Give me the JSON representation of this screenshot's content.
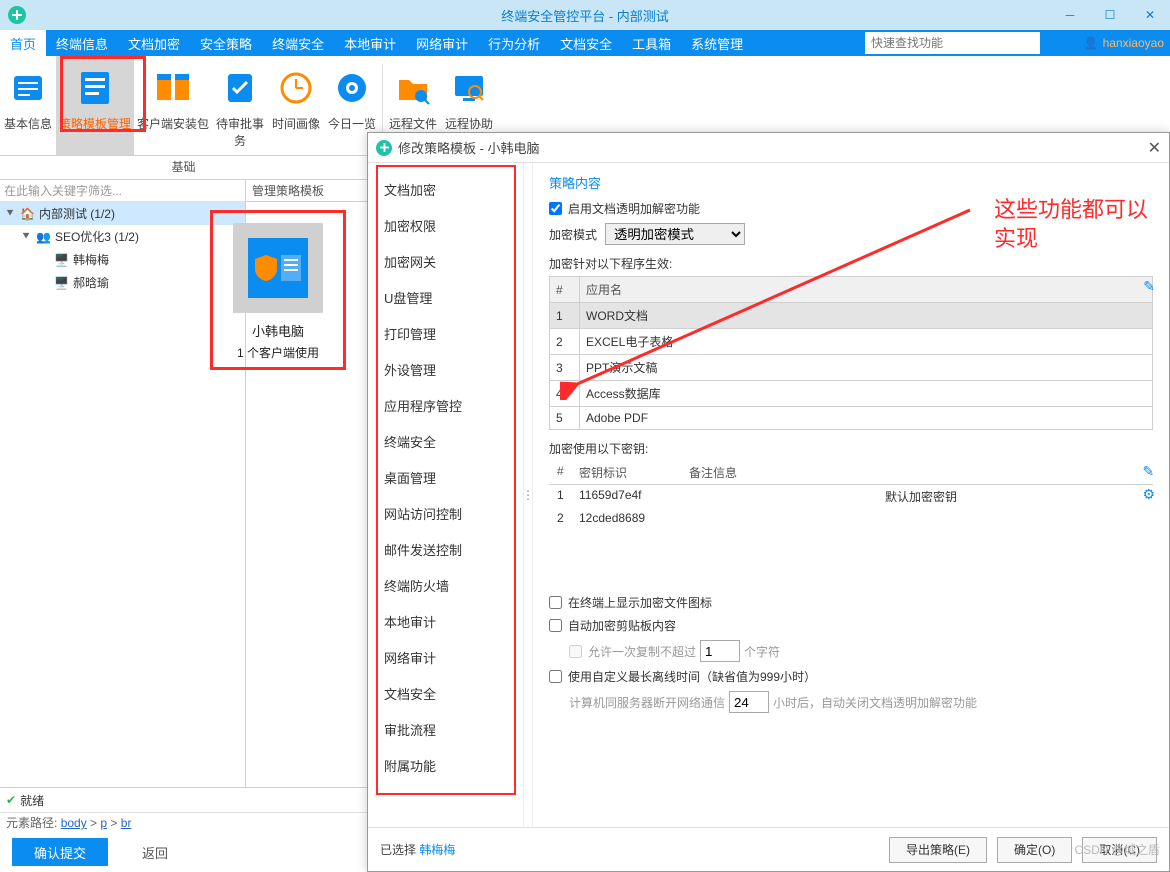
{
  "titlebar": {
    "title": "终端安全管控平台 - 内部测试"
  },
  "menubar": {
    "tabs": [
      "首页",
      "终端信息",
      "文档加密",
      "安全策略",
      "终端安全",
      "本地审计",
      "网络审计",
      "行为分析",
      "文档安全",
      "工具箱",
      "系统管理"
    ],
    "search_placeholder": "快速查找功能",
    "user": "hanxiaoyao"
  },
  "ribbon": {
    "items": [
      {
        "label": "基本信息",
        "icon": "info"
      },
      {
        "label": "策略模板管理",
        "icon": "template",
        "highlighted": true
      },
      {
        "label": "客户端安装包",
        "icon": "package"
      },
      {
        "label": "待审批事务",
        "icon": "approve"
      },
      {
        "label": "时间画像",
        "icon": "clock"
      },
      {
        "label": "今日一览",
        "icon": "eye"
      },
      {
        "label": "远程文件",
        "icon": "folder"
      },
      {
        "label": "远程协助",
        "icon": "remote"
      }
    ],
    "section": "基础"
  },
  "tree": {
    "filter_placeholder": "在此输入关键字筛选...",
    "nodes": [
      {
        "label": "内部测试 (1/2)",
        "icon": "home",
        "lvl": 1,
        "sel": true
      },
      {
        "label": "SEO优化3 (1/2)",
        "icon": "group",
        "lvl": 2
      },
      {
        "label": "韩梅梅",
        "icon": "user-on",
        "lvl": 3
      },
      {
        "label": "郝晗瑜",
        "icon": "user-off",
        "lvl": 3
      }
    ]
  },
  "rightcol": {
    "header": "管理策略模板",
    "card_name": "小韩电脑",
    "card_sub": "1 个客户端使用"
  },
  "dialog": {
    "title": "修改策略模板 - 小韩电脑",
    "side_items": [
      "文档加密",
      "加密权限",
      "加密网关",
      "U盘管理",
      "打印管理",
      "外设管理",
      "应用程序管控",
      "终端安全",
      "桌面管理",
      "网站访问控制",
      "邮件发送控制",
      "终端防火墙",
      "本地审计",
      "网络审计",
      "文档安全",
      "审批流程",
      "附属功能"
    ],
    "content": {
      "heading": "策略内容",
      "chk_enable": "启用文档透明加解密功能",
      "mode_label": "加密模式",
      "mode_value": "透明加密模式",
      "apply_label": "加密针对以下程序生效:",
      "apps_header": [
        "#",
        "应用名"
      ],
      "apps": [
        [
          "1",
          "WORD文档"
        ],
        [
          "2",
          "EXCEL电子表格"
        ],
        [
          "3",
          "PPT演示文稿"
        ],
        [
          "4",
          "Access数据库"
        ],
        [
          "5",
          "Adobe PDF"
        ]
      ],
      "key_label": "加密使用以下密钥:",
      "key_header": [
        "#",
        "密钥标识",
        "备注信息"
      ],
      "keys": [
        [
          "1",
          "11659d7e4f",
          "默认加密密钥"
        ],
        [
          "2",
          "12cded8689",
          ""
        ]
      ],
      "chk_showicon": "在终端上显示加密文件图标",
      "chk_clip": "自动加密剪贴板内容",
      "copy_label_pre": "允许一次复制不超过",
      "copy_value": "1",
      "copy_label_post": "个字符",
      "chk_offline": "使用自定义最长离线时间（缺省值为999小时）",
      "offline_pre": "计算机同服务器断开网络通信",
      "offline_value": "24",
      "offline_post": "小时后，自动关闭文档透明加解密功能"
    },
    "footer": {
      "selected_pre": "已选择",
      "selected_link": "韩梅梅",
      "export": "导出策略(E)",
      "ok": "确定(O)",
      "cancel": "取消(C)"
    }
  },
  "status": {
    "ready": "就绪"
  },
  "crumb": {
    "prefix": "元素路径:",
    "b": "body",
    "p": "p",
    "br": "br"
  },
  "bottom": {
    "submit": "确认提交",
    "back": "返回"
  },
  "annotation": {
    "line1": "这些功能都可以",
    "line2": "实现"
  },
  "watermark": "CSDN @域之盾"
}
